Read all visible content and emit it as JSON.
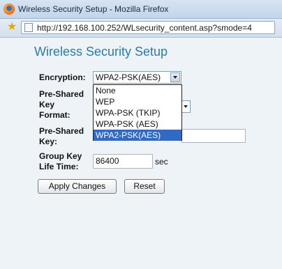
{
  "window": {
    "title": "Wireless Security Setup - Mozilla Firefox"
  },
  "addressbar": {
    "url": "http://192.168.100.252/WLsecurity_content.asp?smode=4"
  },
  "page": {
    "heading": "Wireless Security Setup",
    "encryption": {
      "label": "Encryption:",
      "selected": "WPA2-PSK(AES)",
      "options": [
        "None",
        "WEP",
        "WPA-PSK (TKIP)",
        "WPA-PSK (AES)",
        "WPA2-PSK(AES)"
      ]
    },
    "psk_format": {
      "label_line1": "Pre-Shared",
      "label_line2": "Key",
      "label_line3": "Format:"
    },
    "psk": {
      "label_line1": "Pre-Shared",
      "label_line2": "Key:",
      "value": ""
    },
    "group_key": {
      "label_line1": "Group Key",
      "label_line2": "Life Time:",
      "value": "86400",
      "unit": "sec"
    },
    "buttons": {
      "apply": "Apply Changes",
      "reset": "Reset"
    }
  }
}
